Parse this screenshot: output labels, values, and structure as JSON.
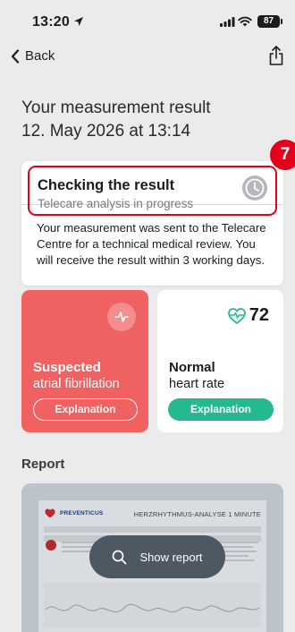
{
  "status_bar": {
    "time": "13:20",
    "battery": "87"
  },
  "nav": {
    "back_label": "Back"
  },
  "title": {
    "line1": "Your measurement result",
    "line2": "12. May 2026 at 13:14"
  },
  "status_card": {
    "title": "Checking the result",
    "subtitle": "Telecare analysis in progress",
    "body": "Your measurement was sent to the Telecare Centre for a technical medical review. You will receive the result within 3 working days."
  },
  "step_badge": "7",
  "afib_card": {
    "title": "Suspected",
    "subtitle": "atrial fibrillation",
    "button_label": "Explanation"
  },
  "heart_rate_card": {
    "value": "72",
    "title": "Normal",
    "subtitle": "heart rate",
    "button_label": "Explanation"
  },
  "report": {
    "heading": "Report",
    "logo_text": "PREVENTICUS",
    "document_title": "HERZRHYTHMUS-ANALYSE 1 MINUTE",
    "button_label": "Show report"
  },
  "colors": {
    "highlight_red": "#e3001b",
    "afib_card": "#f06262",
    "explanation_green": "#24b98e",
    "show_report_button": "#4d5862"
  }
}
